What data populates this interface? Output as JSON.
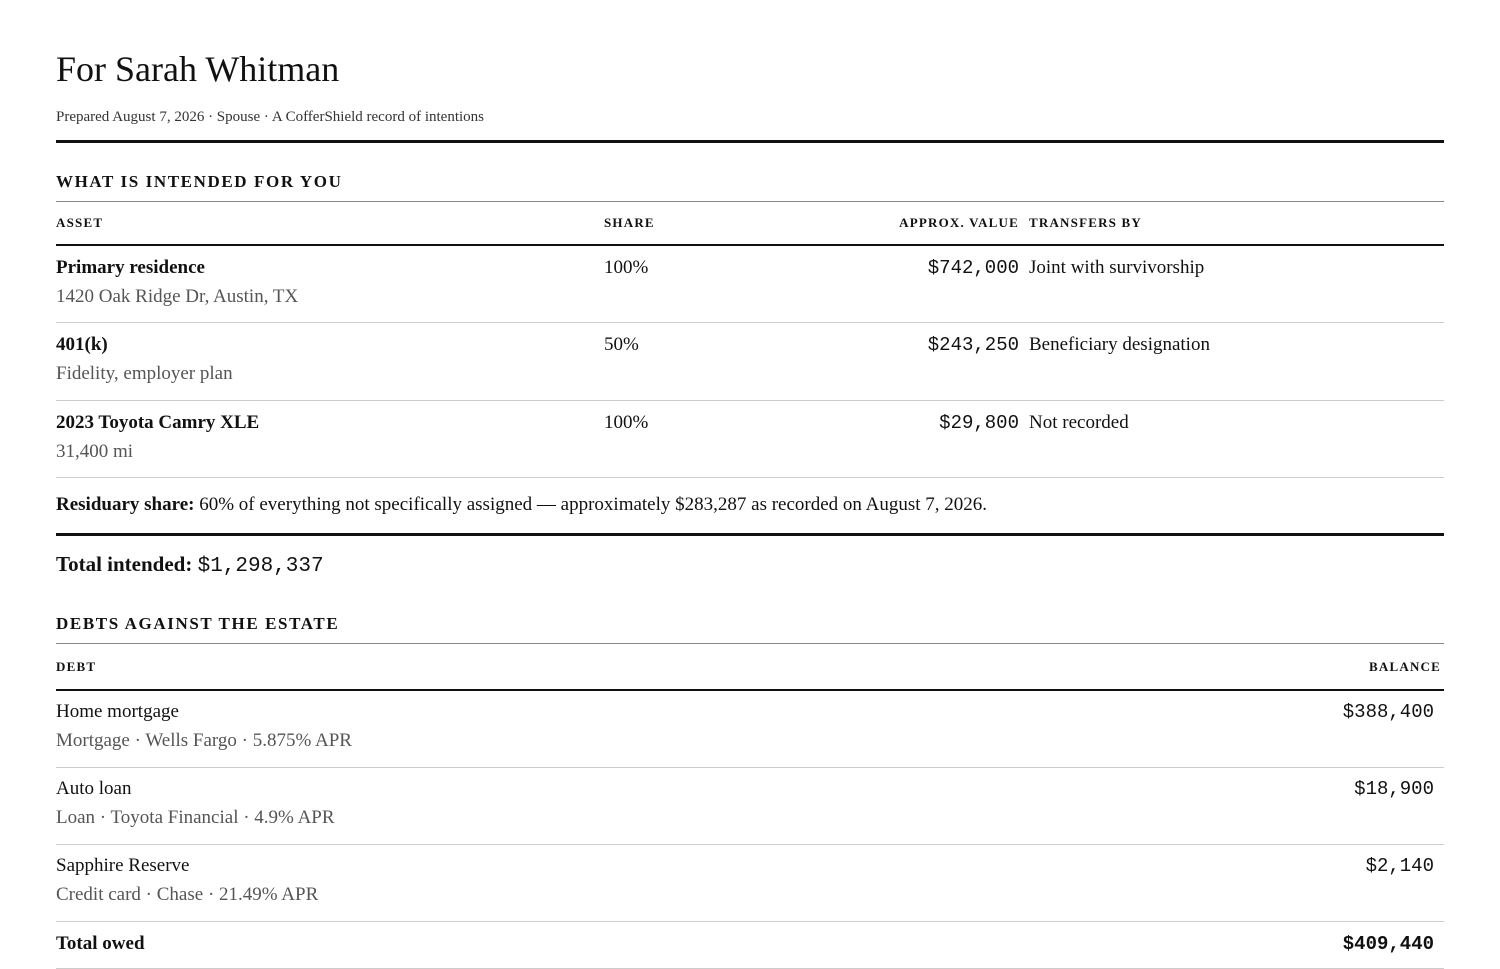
{
  "header": {
    "title": "For Sarah Whitman",
    "meta": "Prepared August 7, 2026 · Spouse · A CofferShield record of intentions"
  },
  "intended": {
    "section_title": "What is intended for you",
    "columns": {
      "asset": "Asset",
      "share": "Share",
      "value": "Approx. value",
      "transfer": "Transfers by"
    },
    "rows": [
      {
        "name": "Primary residence",
        "detail": "1420 Oak Ridge Dr, Austin, TX",
        "share": "100%",
        "value": "$742,000",
        "transfer": "Joint with survivorship"
      },
      {
        "name": "401(k)",
        "detail": "Fidelity, employer plan",
        "share": "50%",
        "value": "$243,250",
        "transfer": "Beneficiary designation"
      },
      {
        "name": "2023 Toyota Camry XLE",
        "detail": "31,400 mi",
        "share": "100%",
        "value": "$29,800",
        "transfer": "Not recorded"
      }
    ],
    "residuary_label": "Residuary share:",
    "residuary_text": " 60% of everything not specifically assigned — approximately $283,287 as recorded on August 7, 2026.",
    "total_label": "Total intended:",
    "total_value": "$1,298,337"
  },
  "debts": {
    "section_title": "Debts against the estate",
    "columns": {
      "debt": "Debt",
      "balance": "Balance"
    },
    "rows": [
      {
        "name": "Home mortgage",
        "detail": "Mortgage · Wells Fargo · 5.875% APR",
        "balance": "$388,400"
      },
      {
        "name": "Auto loan",
        "detail": "Loan · Toyota Financial · 4.9% APR",
        "balance": "$18,900"
      },
      {
        "name": "Sapphire Reserve",
        "detail": "Credit card · Chase · 21.49% APR",
        "balance": "$2,140"
      }
    ],
    "total_label": "Total owed",
    "total_value": "$409,440"
  }
}
